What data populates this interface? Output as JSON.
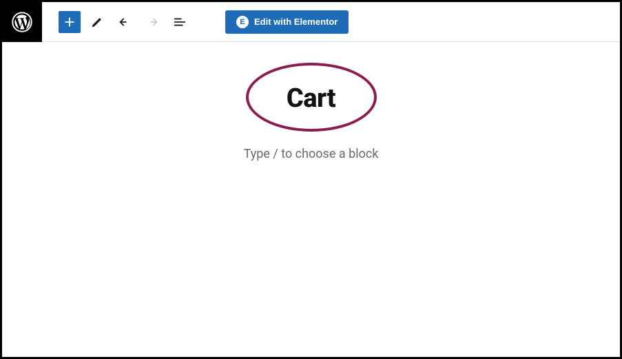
{
  "toolbar": {
    "elementor_label": "Edit with Elementor"
  },
  "editor": {
    "title": "Cart",
    "placeholder": "Type / to choose a block"
  },
  "colors": {
    "accent": "#1e6bb8",
    "annotation": "#8b1e4f"
  }
}
